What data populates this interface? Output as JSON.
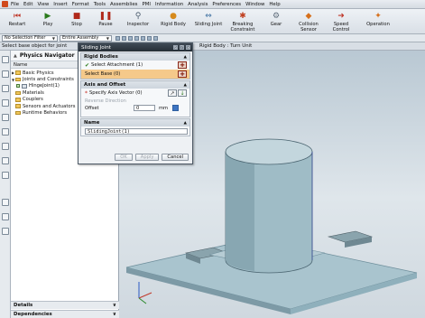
{
  "menu": [
    "File",
    "Edit",
    "View",
    "Insert",
    "Format",
    "Tools",
    "Assemblies",
    "PMI",
    "Information",
    "Analysis",
    "Preferences",
    "Window",
    "Help"
  ],
  "toolbar": [
    {
      "label": "Restart",
      "icon": "restart-icon"
    },
    {
      "label": "Play",
      "icon": "play-icon"
    },
    {
      "label": "Stop",
      "icon": "stop-icon"
    },
    {
      "label": "Pause",
      "icon": "pause-icon"
    },
    {
      "label": "Inspector",
      "icon": "inspector-icon"
    },
    {
      "label": "Rigid Body",
      "icon": "rigid-body-icon"
    },
    {
      "label": "Sliding Joint",
      "icon": "sliding-joint-icon"
    },
    {
      "label": "Breaking Constraint",
      "icon": "breaking-constraint-icon"
    },
    {
      "label": "Gear",
      "icon": "gear-icon"
    },
    {
      "label": "Collision Sensor",
      "icon": "collision-sensor-icon"
    },
    {
      "label": "Speed Control",
      "icon": "speed-control-icon"
    },
    {
      "label": "Operation",
      "icon": "operation-icon"
    }
  ],
  "selection": {
    "filter": "No Selection Filter",
    "scope": "Entire Assembly"
  },
  "status": {
    "prompt": "Select base object for joint",
    "info": "Rigid Body : Turn Unit"
  },
  "navigator": {
    "title": "Physics Navigator",
    "column": "Name",
    "items": [
      {
        "label": "Basic Physics",
        "level": 0,
        "type": "folder"
      },
      {
        "label": "Joints and Constraints",
        "level": 0,
        "type": "folder"
      },
      {
        "label": "HingeJoint(1)",
        "level": 1,
        "type": "joint"
      },
      {
        "label": "Materials",
        "level": 0,
        "type": "folder"
      },
      {
        "label": "Couplers",
        "level": 0,
        "type": "folder"
      },
      {
        "label": "Sensors and Actuators",
        "level": 0,
        "type": "folder"
      },
      {
        "label": "Runtime Behaviors",
        "level": 0,
        "type": "folder"
      }
    ],
    "details": "Details",
    "dependencies": "Dependencies"
  },
  "dialog": {
    "title": "Sliding Joint",
    "rigid_bodies": {
      "header": "Rigid Bodies",
      "attachment": "Select Attachment (1)",
      "base": "Select Base (0)"
    },
    "axis": {
      "header": "Axis and Offset",
      "vector": "Specify Axis Vector (0)",
      "reverse": "Reverse Direction",
      "offset_label": "Offset",
      "offset_value": "0",
      "unit": "mm"
    },
    "name": {
      "header": "Name",
      "value": "SlidingJoint(1)"
    },
    "buttons": {
      "ok": "OK",
      "apply": "Apply",
      "cancel": "Cancel"
    }
  },
  "colors": {
    "accent": "#f5c98a",
    "title_bar": "#2b333b",
    "model": "#9fbcc6"
  }
}
